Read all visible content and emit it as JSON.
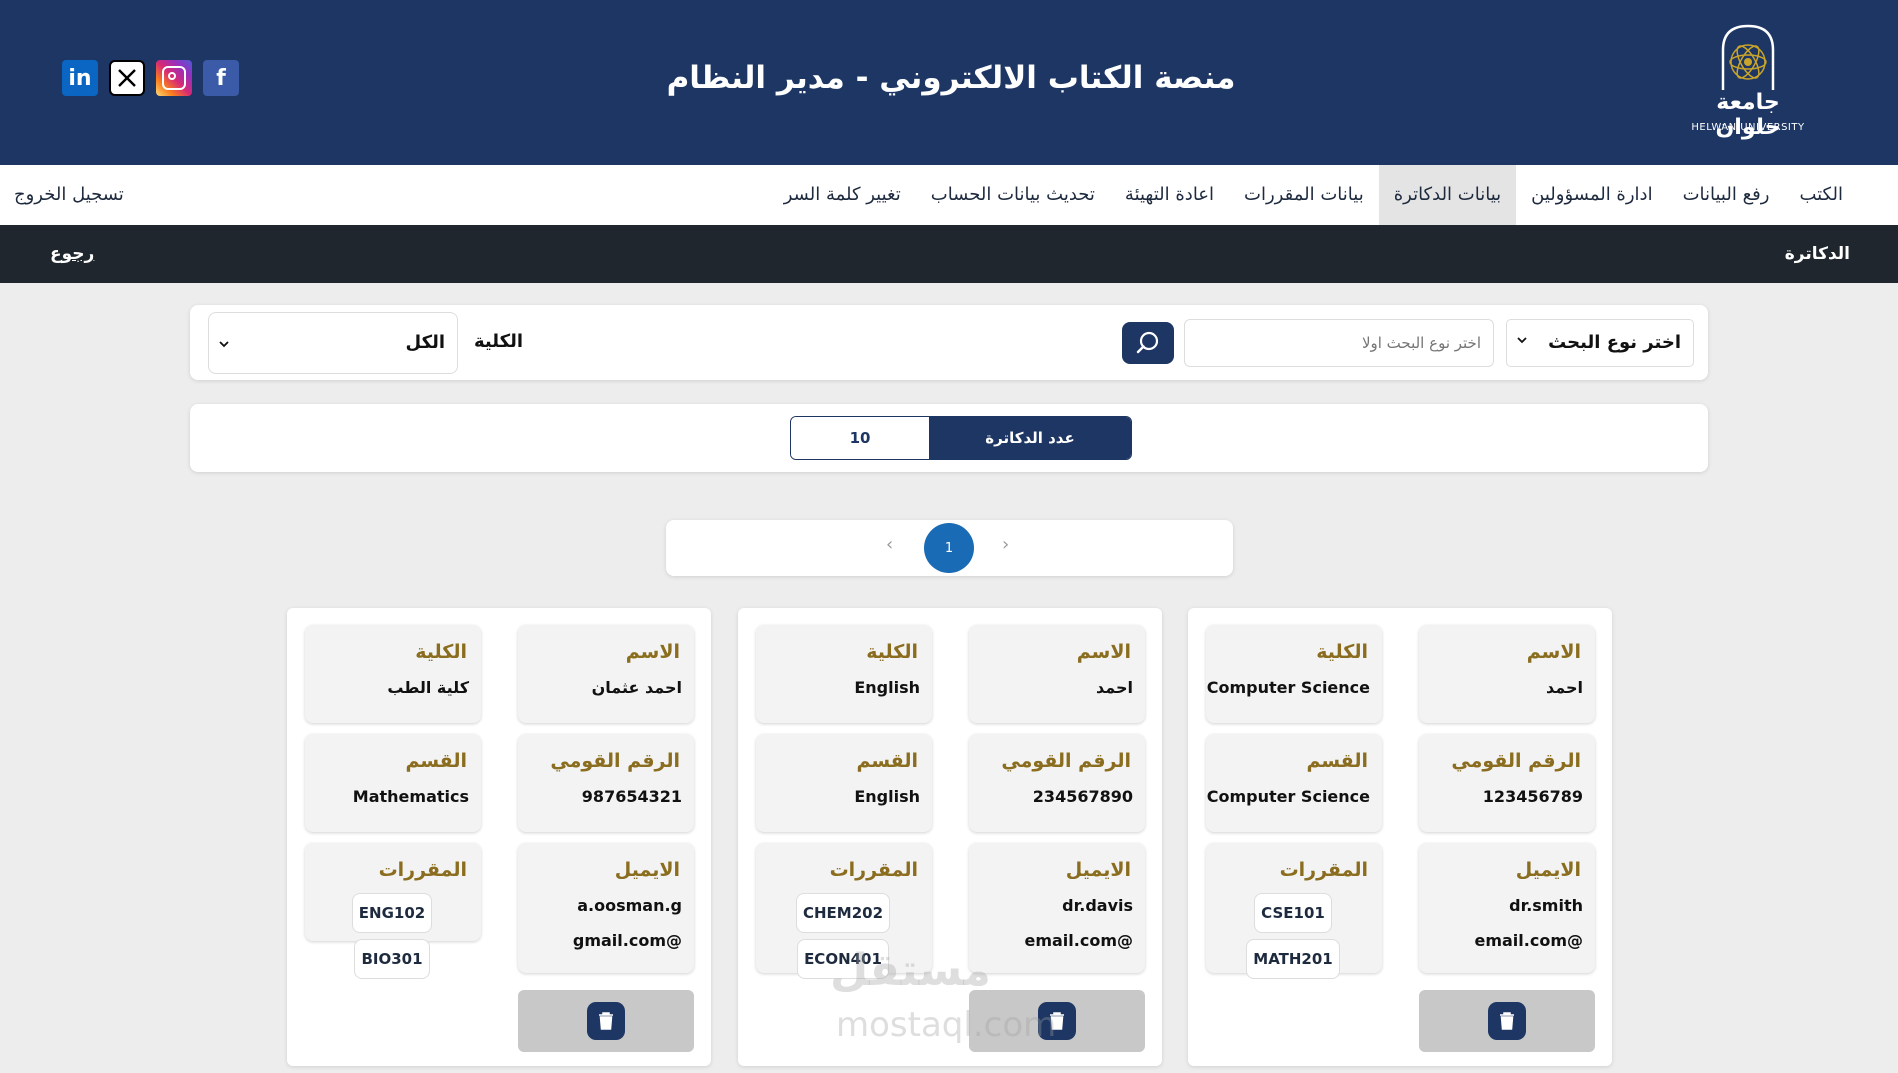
{
  "header": {
    "title": "منصة الكتاب الالكتروني - مدير النظام",
    "logo_arabic": "جامعة حلوان",
    "logo_english": "HELWAN UNIVERSITY",
    "social": {
      "linkedin": "in",
      "facebook": "f"
    }
  },
  "nav": {
    "items": [
      "الكتب",
      "رفع البيانات",
      "ادارة المسؤولين",
      "بيانات الدكاترة",
      "بيانات المقررات",
      "اعادة التهيئة",
      "تحديث بيانات الحساب",
      "تغيير كلمة السر"
    ],
    "active": "بيانات الدكاترة",
    "logout": "تسجيل الخروج"
  },
  "breadcrumb": {
    "title": "الدكاترة",
    "back": "رجوع"
  },
  "search": {
    "type_label": "اختر نوع البحث",
    "placeholder": "اختر نوع البحث اولا",
    "faculty_label": "الكلية",
    "faculty_value": "الكل"
  },
  "count": {
    "label": "عدد الدكاترة",
    "value": "10"
  },
  "pagination": {
    "current": "1",
    "prev": "‹",
    "next": "›"
  },
  "labels": {
    "name": "الاسم",
    "faculty": "الكلية",
    "national_id": "الرقم القومي",
    "department": "القسم",
    "email": "الايميل",
    "courses": "المقررات"
  },
  "doctors": [
    {
      "name": "احمد",
      "faculty": "Computer Science",
      "national_id": "123456789",
      "department": "Computer Science",
      "email_line1": "dr.smith",
      "email_line2": "@email.com",
      "courses": [
        "CSE101",
        "MATH201"
      ]
    },
    {
      "name": "احمد",
      "faculty": "English",
      "national_id": "234567890",
      "department": "English",
      "email_line1": "dr.davis",
      "email_line2": "@email.com",
      "courses": [
        "CHEM202",
        "ECON401"
      ]
    },
    {
      "name": "احمد عثمان",
      "faculty": "كلية الطب",
      "national_id": "987654321",
      "department": "Mathematics",
      "email_line1": "a.oosman.g",
      "email_line2": "@gmail.com",
      "courses": [
        "ENG102",
        "BIO301"
      ]
    }
  ],
  "watermark": {
    "line1": "مستقل",
    "line2": "mostaql.com"
  },
  "colors": {
    "primary": "#1d3663",
    "label_gold": "#8a6d1e",
    "page_bg": "#ededed",
    "active_page": "#1a6bb5"
  }
}
